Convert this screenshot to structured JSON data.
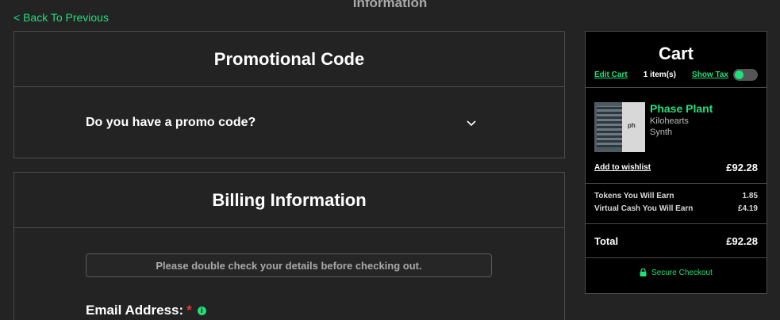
{
  "page": {
    "top_title": "Information",
    "back_link": "< Back To Previous"
  },
  "promo": {
    "title": "Promotional Code",
    "question": "Do you have a promo code?"
  },
  "billing": {
    "title": "Billing Information",
    "notice": "Please double check your details before checking out.",
    "email_label": "Email Address:",
    "required_mark": "*",
    "info_icon": "i"
  },
  "cart": {
    "title": "Cart",
    "edit_label": "Edit Cart",
    "item_count": "1 item(s)",
    "show_tax_label": "Show Tax",
    "show_tax_on": true,
    "item": {
      "name": "Phase Plant",
      "brand": "Kilohearts",
      "category": "Synth",
      "thumb_tag": "ph",
      "price": "£92.28"
    },
    "wishlist_label": "Add to wishlist",
    "tokens_label": "Tokens You Will Earn",
    "tokens_value": "1.85",
    "virtual_cash_label": "Virtual Cash You Will Earn",
    "virtual_cash_value": "£4.19",
    "total_label": "Total",
    "total_value": "£92.28",
    "secure_label": "Secure Checkout"
  },
  "colors": {
    "accent": "#1fe07a",
    "background": "#232323",
    "cart_background": "#000000",
    "required": "#e53935"
  },
  "icons": {
    "chevron": "chevron-down-icon",
    "lock": "lock-icon",
    "info": "info-icon"
  }
}
